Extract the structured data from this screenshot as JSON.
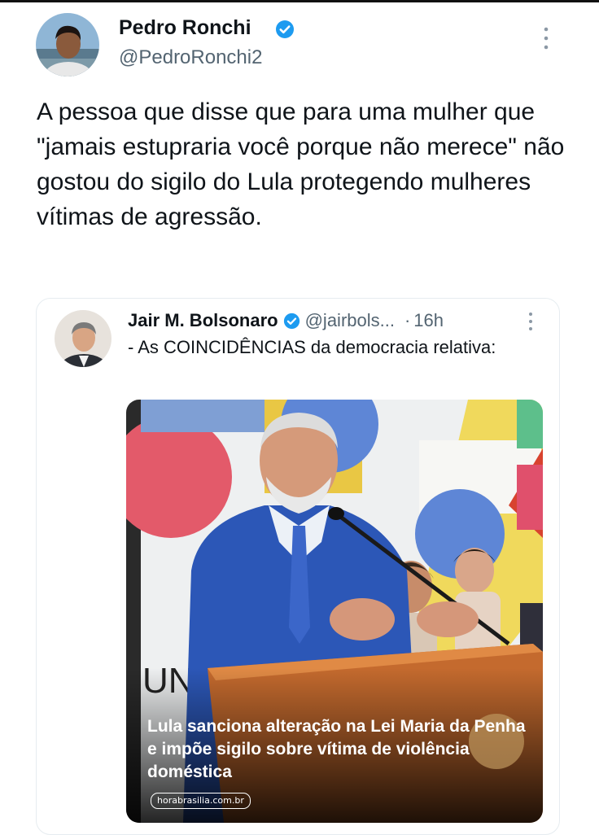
{
  "tweet": {
    "author_name": "Pedro Ronchi",
    "author_handle": "@PedroRonchi2",
    "text": "A pessoa que disse que para uma mulher que \"jamais estupraria você porque não merece\" não gostou do sigilo do Lula protegendo mulheres vítimas de agressão.",
    "verified": true,
    "more_icon": "more-vertical-icon"
  },
  "quoted_tweet": {
    "author_name": "Jair M. Bolsonaro",
    "author_handle": "@jairbols...",
    "separator": "·",
    "timestamp": "16h",
    "text": "- As COINCIDÊNCIAS da democracia relativa:",
    "verified": true,
    "more_icon": "more-vertical-icon",
    "media": {
      "headline": "Lula sanciona alteração na Lei Maria da Penha e impõe sigilo sobre vítima de violência doméstica",
      "source": "horabrasilia.com.br"
    }
  },
  "colors": {
    "text_primary": "#0f1419",
    "text_secondary": "#536471",
    "verified_blue": "#1d9bf0",
    "border": "#e6ecf0"
  }
}
